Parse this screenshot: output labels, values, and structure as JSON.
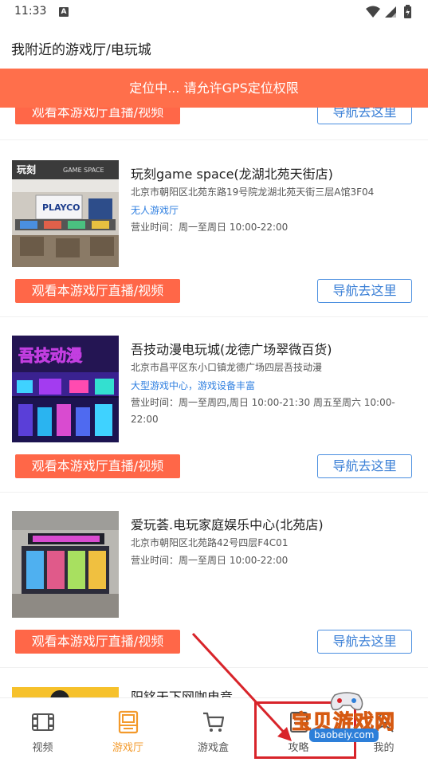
{
  "status_bar": {
    "time": "11:33",
    "notification_letter": "A"
  },
  "header": {
    "title": "我附近的游戏厅/电玩城"
  },
  "gps_banner": "定位中... 请允许GPS定位权限",
  "buttons": {
    "watch_label": "观看本游戏厅直播/视频",
    "nav_label": "导航去这里"
  },
  "venues": [
    {
      "name": "玩刻game space(龙湖北苑天街店)",
      "address": "北京市朝阳区北苑东路19号院龙湖北苑天街三层A馆3F04",
      "tag": "无人游戏厅",
      "hours": "营业时间：周一至周日 10:00-22:00",
      "photo_text": {
        "logo": "玩刻",
        "sub": "GAME SPACE",
        "sign": "PLAYCO"
      }
    },
    {
      "name": "吾技动漫电玩城(龙德广场翠微百货)",
      "address": "北京市昌平区东小口镇龙德广场四层吾技动漫",
      "tag": "大型游戏中心，游戏设备丰富",
      "hours": "营业时间：周一至周四,周日 10:00-21:30 周五至周六 10:00-22:00",
      "photo_text": {
        "logo": "吾技动漫"
      }
    },
    {
      "name": "爱玩荟.电玩家庭娱乐中心(北苑店)",
      "address": "北京市朝阳区北苑路42号四层F4C01",
      "tag": "",
      "hours": "营业时间：周一至周日 10:00-22:00"
    },
    {
      "name": "阳铭天下网咖电竞"
    }
  ],
  "tabs": [
    {
      "label": "视频",
      "icon": "film-icon"
    },
    {
      "label": "游戏厅",
      "icon": "arcade-machine-icon"
    },
    {
      "label": "游戏盒",
      "icon": "shopping-cart-icon"
    },
    {
      "label": "攻略",
      "icon": "guide-icon"
    },
    {
      "label": "我的",
      "icon": "user-icon"
    }
  ],
  "active_tab": "游戏厅",
  "watermark": {
    "text": "宝贝游戏网",
    "url": "baobeiy.com"
  },
  "colors": {
    "banner": "#ff6f4b",
    "watch_button": "#ff6748",
    "nav_border": "#4b8fe0",
    "tag_text": "#2f7fe0",
    "active_tab": "#f39a2b",
    "annotation_red": "#d8242a"
  }
}
